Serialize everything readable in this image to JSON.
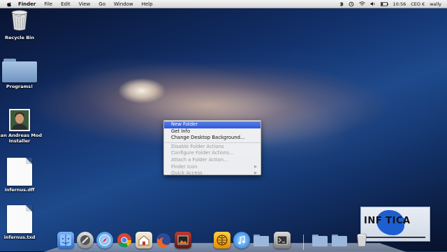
{
  "menubar": {
    "app_name": "Finder",
    "items": [
      "File",
      "Edit",
      "View",
      "Go",
      "Window",
      "Help"
    ],
    "status": {
      "battery": "10:56",
      "clock": "CEO €",
      "user": "wally"
    }
  },
  "desktop": {
    "icons": [
      {
        "label": "Recycle Bin",
        "icon": "trash-icon"
      },
      {
        "label": "Programs!",
        "icon": "folder-icon"
      },
      {
        "label": "San Andreas Mod Installer",
        "icon": "app-photo-icon"
      },
      {
        "label": "infernus.dff",
        "icon": "document-icon"
      },
      {
        "label": "infernus.txd",
        "icon": "document-icon"
      }
    ]
  },
  "context_menu": {
    "items": [
      {
        "label": "New Folder",
        "enabled": true,
        "selected": true,
        "submenu": false
      },
      {
        "label": "Get Info",
        "enabled": true,
        "selected": false,
        "submenu": false
      },
      {
        "label": "Change Desktop Background...",
        "enabled": true,
        "selected": false,
        "submenu": false
      },
      {
        "label": "Disable Folder Actions",
        "enabled": false,
        "selected": false,
        "submenu": false
      },
      {
        "label": "Configure Folder Actions...",
        "enabled": false,
        "selected": false,
        "submenu": false
      },
      {
        "label": "Attach a Folder Action...",
        "enabled": false,
        "selected": false,
        "submenu": false
      },
      {
        "label": "Finder Icon",
        "enabled": false,
        "selected": false,
        "submenu": true
      },
      {
        "label": "Quick Access",
        "enabled": false,
        "selected": false,
        "submenu": true
      }
    ]
  },
  "watermark": {
    "text": "INF TICA"
  },
  "dock": {
    "apps": [
      "finder-icon",
      "utility-icon",
      "safari-icon",
      "chrome-icon",
      "home-icon",
      "firefox-icon",
      "photo-app-icon",
      "network-icon",
      "itunes-icon",
      "folder-icon"
    ],
    "stacks": [
      "folder-stack-icon",
      "folder-stack-icon",
      "trash-icon"
    ]
  },
  "colors": {
    "menu_highlight": "#2f58d8",
    "folder_blue": "#7fa0c8"
  }
}
